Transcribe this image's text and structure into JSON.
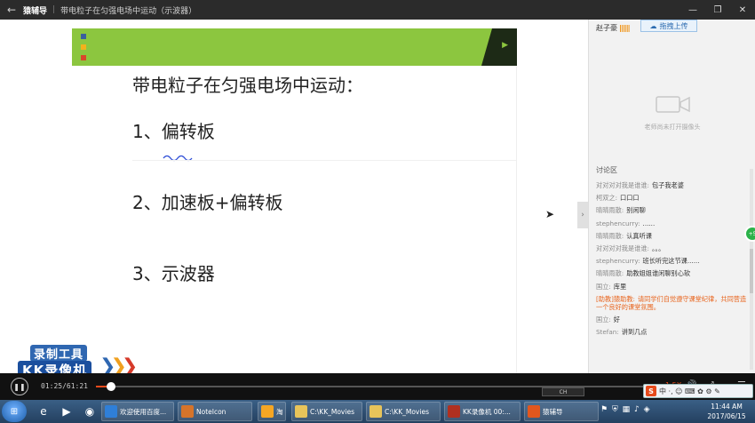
{
  "titlebar": {
    "app_name": "猿辅导",
    "separator": "|",
    "lesson_title": "带电粒子在匀强电场中运动（示波器）",
    "back_icon": "arrow-left-icon",
    "minimize_icon": "minimize-icon",
    "maximize_icon": "maximize-icon",
    "close_icon": "close-icon"
  },
  "slide": {
    "title": "带电粒子在匀强电场中运动：",
    "items": [
      "1、偏转板",
      "2、加速板+偏转板",
      "3、示波器"
    ],
    "header_color": "#8cc63f",
    "square_colors": [
      "#3a5f9e",
      "#f2b21c",
      "#d9452b"
    ]
  },
  "watermark": {
    "line1": "录制工具",
    "line2": "KK录像机"
  },
  "panel": {
    "teacher_name": "赵子豪",
    "share_button": "拖拽上传",
    "camera_status": "老师尚未打开摄像头",
    "discussion_label": "讨论区",
    "messages": [
      {
        "user": "对对对对我是谁谁:",
        "text": "包子我老婆"
      },
      {
        "user": "柯双之:",
        "text": "口口口"
      },
      {
        "user": "晴晴雨散:",
        "text": "别闲聊"
      },
      {
        "user": "stephencurry:",
        "text": "......"
      },
      {
        "user": "晴晴雨散:",
        "text": "认真听课"
      },
      {
        "user": "对对对对我是谁谁:",
        "text": "。。。"
      },
      {
        "user": "stephencurry:",
        "text": "班长听完这节课......"
      },
      {
        "user": "晴晴雨散:",
        "text": "助教姐姐谁闲聊别心软"
      },
      {
        "user": "国立:",
        "text": "库里"
      },
      {
        "user": "[助教]猿助教:",
        "text": "请同学们自觉遵守课堂纪律，共同营造一个良好的课堂氛围。",
        "notice": true
      },
      {
        "user": "国立:",
        "text": "好"
      },
      {
        "user": "Stefan:",
        "text": "讲到几点"
      }
    ],
    "badge_text": "+5"
  },
  "player": {
    "time": "01:25/61:21",
    "progress_fraction": 0.023,
    "speed": "1.5X",
    "ime_label": "CH",
    "sogou_text": "中 ·, ☺ ⌨ ✿ ⚙ ✎"
  },
  "taskbar": {
    "pinned": [
      "internet-explorer-icon",
      "media-player-icon",
      "browser-icon"
    ],
    "tasks": [
      {
        "label": "欢迎使用百度...",
        "color": "#2f7fd8"
      },
      {
        "label": "NoteIcon",
        "color": "#d6742a"
      },
      {
        "label": "淘",
        "color": "#f6a623"
      },
      {
        "label": "C:\\KK_Movies",
        "color": "#e8c45a"
      },
      {
        "label": "C:\\KK_Movies",
        "color": "#e8c45a"
      },
      {
        "label": "KK录像机 00:...",
        "color": "#b03020"
      },
      {
        "label": "猿辅导",
        "color": "#e2571e"
      }
    ],
    "time": "11:44 AM",
    "date": "2017/06/15"
  }
}
